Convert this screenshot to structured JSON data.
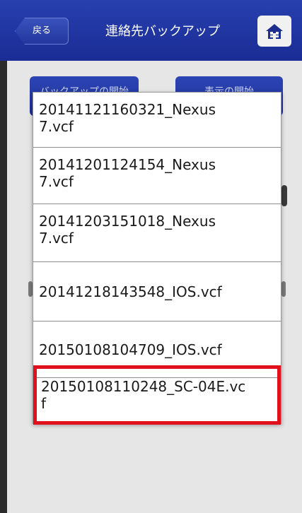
{
  "header": {
    "back_label": "戻る",
    "title": "連絡先バックアップ",
    "home_icon": "home-icon"
  },
  "background": {
    "left_button_label": "バックアップの開始",
    "right_button_label": "表示の開始"
  },
  "file_list": {
    "items": [
      {
        "name": "20141121160321_Nexus\n7.vcf"
      },
      {
        "name": "20141201124154_Nexus\n7.vcf"
      },
      {
        "name": "20141203151018_Nexus\n7.vcf"
      },
      {
        "name": "20141218143548_IOS.vcf"
      },
      {
        "name": "20150108104709_IOS.vcf"
      },
      {
        "name": "20150108110248_SC-04E.vc\nf"
      }
    ],
    "selected_index": 5
  },
  "colors": {
    "header_blue": "#2740ae",
    "highlight_red": "#e0101d",
    "background_gray": "#e6e6e6"
  }
}
